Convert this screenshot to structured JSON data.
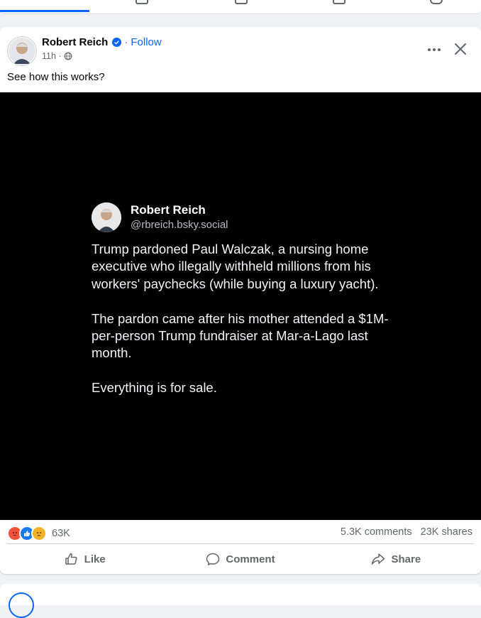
{
  "post": {
    "author": "Robert Reich",
    "follow_label": "Follow",
    "separator": "·",
    "time": "11h ·",
    "caption": "See how this works?",
    "embedded": {
      "name": "Robert Reich",
      "handle": "@rbreich.bsky.social",
      "paragraphs": [
        "Trump pardoned Paul Walczak, a nursing home executive who illegally withheld millions from his workers' paychecks (while buying a luxury yacht).",
        "The pardon came after his mother attended a $1M-per-person Trump fundraiser at Mar-a-Lago last month.",
        "Everything is for sale."
      ]
    },
    "reactions_count": "63K",
    "comments": "5.3K comments",
    "shares": "23K shares",
    "actions": {
      "like": "Like",
      "comment": "Comment",
      "share": "Share"
    }
  },
  "colors": {
    "accent": "#0866ff",
    "muted": "#65676b",
    "background": "#f0f2f5"
  },
  "icons": [
    "verified-badge-icon",
    "globe-icon",
    "more-icon",
    "close-icon",
    "angry-reaction-icon",
    "like-reaction-icon",
    "sad-reaction-icon",
    "thumbs-up-icon",
    "comment-icon",
    "share-icon"
  ]
}
